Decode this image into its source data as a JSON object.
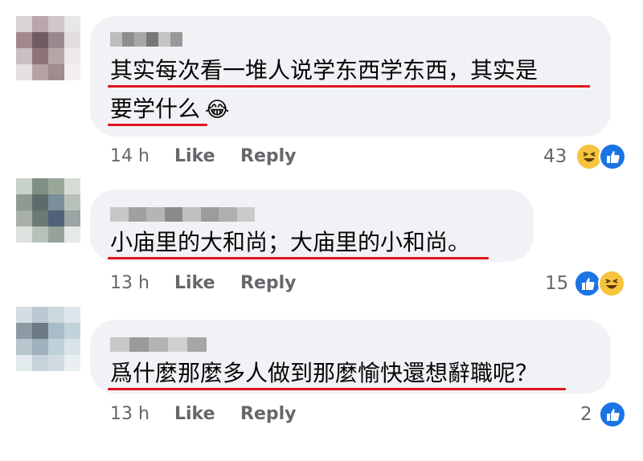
{
  "comments": [
    {
      "text_line1": "其实每次看一堆人说学东西学东西，其实是",
      "text_line2": "要学什么",
      "emoji": "😂",
      "time": "14 h",
      "like_label": "Like",
      "reply_label": "Reply",
      "reaction_count": "43",
      "reactions": [
        "haha-icon",
        "like-icon"
      ]
    },
    {
      "text_line1": "小庙里的大和尚；大庙里的小和尚。",
      "time": "13 h",
      "like_label": "Like",
      "reply_label": "Reply",
      "reaction_count": "15",
      "reactions": [
        "like-icon",
        "haha-icon"
      ]
    },
    {
      "text_line1": "爲什麼那麼多人做到那麼愉快還想辭職呢？",
      "time": "13 h",
      "like_label": "Like",
      "reply_label": "Reply",
      "reaction_count": "2",
      "reactions": [
        "like-icon"
      ]
    }
  ],
  "colors": {
    "bubble": "#f0f2f5",
    "underline": "#e0141e",
    "like_blue": "#1b74e4",
    "haha_yellow": "#f7c43e",
    "meta_gray": "#65676b"
  }
}
